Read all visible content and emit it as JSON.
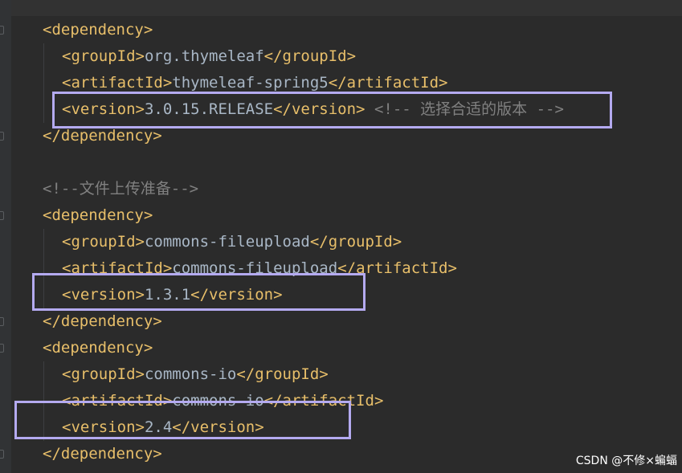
{
  "code_lines": [
    {
      "open": "<dependency>",
      "text": "",
      "close": "",
      "comment": ""
    },
    {
      "open": "<groupId>",
      "text": "org.thymeleaf",
      "close": "</groupId>",
      "comment": ""
    },
    {
      "open": "<artifactId>",
      "text": "thymeleaf-spring5",
      "close": "</artifactId>",
      "comment": ""
    },
    {
      "open": "<version>",
      "text": "3.0.15.RELEASE",
      "close": "</version>",
      "comment": "<!-- 选择合适的版本 -->"
    },
    {
      "open": "</dependency>",
      "text": "",
      "close": "",
      "comment": ""
    },
    {
      "open": "",
      "text": "",
      "close": "",
      "comment": ""
    },
    {
      "open": "",
      "text": "",
      "close": "",
      "comment": "<!--文件上传准备-->"
    },
    {
      "open": "<dependency>",
      "text": "",
      "close": "",
      "comment": ""
    },
    {
      "open": "<groupId>",
      "text": "commons-fileupload",
      "close": "</groupId>",
      "comment": ""
    },
    {
      "open": "<artifactId>",
      "text": "commons-fileupload",
      "close": "</artifactId>",
      "comment": ""
    },
    {
      "open": "<version>",
      "text": "1.3.1",
      "close": "</version>",
      "comment": ""
    },
    {
      "open": "</dependency>",
      "text": "",
      "close": "",
      "comment": ""
    },
    {
      "open": "<dependency>",
      "text": "",
      "close": "",
      "comment": ""
    },
    {
      "open": "<groupId>",
      "text": "commons-io",
      "close": "</groupId>",
      "comment": ""
    },
    {
      "open": "<artifactId>",
      "text": "commons-io",
      "close": "</artifactId>",
      "comment": ""
    },
    {
      "open": "<version>",
      "text": "2.4",
      "close": "</version>",
      "comment": ""
    },
    {
      "open": "</dependency>",
      "text": "",
      "close": "",
      "comment": ""
    }
  ],
  "highlight_color": "#b4aaf0",
  "tag_color": "#e8bf6a",
  "text_color": "#a9b7c6",
  "comment_color": "#808080",
  "watermark": "CSDN @不修×蝙蝠"
}
